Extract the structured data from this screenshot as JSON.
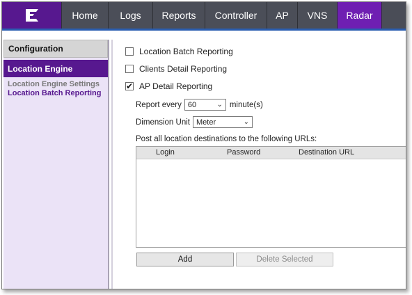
{
  "nav": {
    "logo_icon": "extreme-networks-logo-icon",
    "tabs": [
      {
        "label": "Home"
      },
      {
        "label": "Logs"
      },
      {
        "label": "Reports"
      },
      {
        "label": "Controller"
      },
      {
        "label": "AP"
      },
      {
        "label": "VNS"
      },
      {
        "label": "Radar",
        "active": true
      }
    ]
  },
  "sidebar": {
    "header": "Configuration",
    "active_item": "Location Engine",
    "links": [
      {
        "label": "Location Engine Settings",
        "color": "#7a7a7a"
      },
      {
        "label": "Location Batch Reporting",
        "color": "#57188f"
      }
    ]
  },
  "options": {
    "location_batch": {
      "label": "Location Batch Reporting",
      "checked": false
    },
    "clients_detail": {
      "label": "Clients Detail Reporting",
      "checked": false
    },
    "ap_detail": {
      "label": "AP Detail Reporting",
      "checked": true
    }
  },
  "report_every": {
    "label": "Report every",
    "value": "60",
    "unit": "minute(s)"
  },
  "dimension_unit": {
    "label": "Dimension Unit",
    "value": "Meter"
  },
  "urls": {
    "label": "Post all location destinations to the following URLs:",
    "columns": [
      "Login",
      "Password",
      "Destination URL"
    ],
    "rows": []
  },
  "buttons": {
    "add": "Add",
    "delete_selected": "Delete Selected"
  },
  "colors": {
    "brand_purple": "#57188f",
    "active_tab": "#6f1fb2",
    "nav_bg": "#4a4d57",
    "accent_blue": "#2a5db0"
  }
}
